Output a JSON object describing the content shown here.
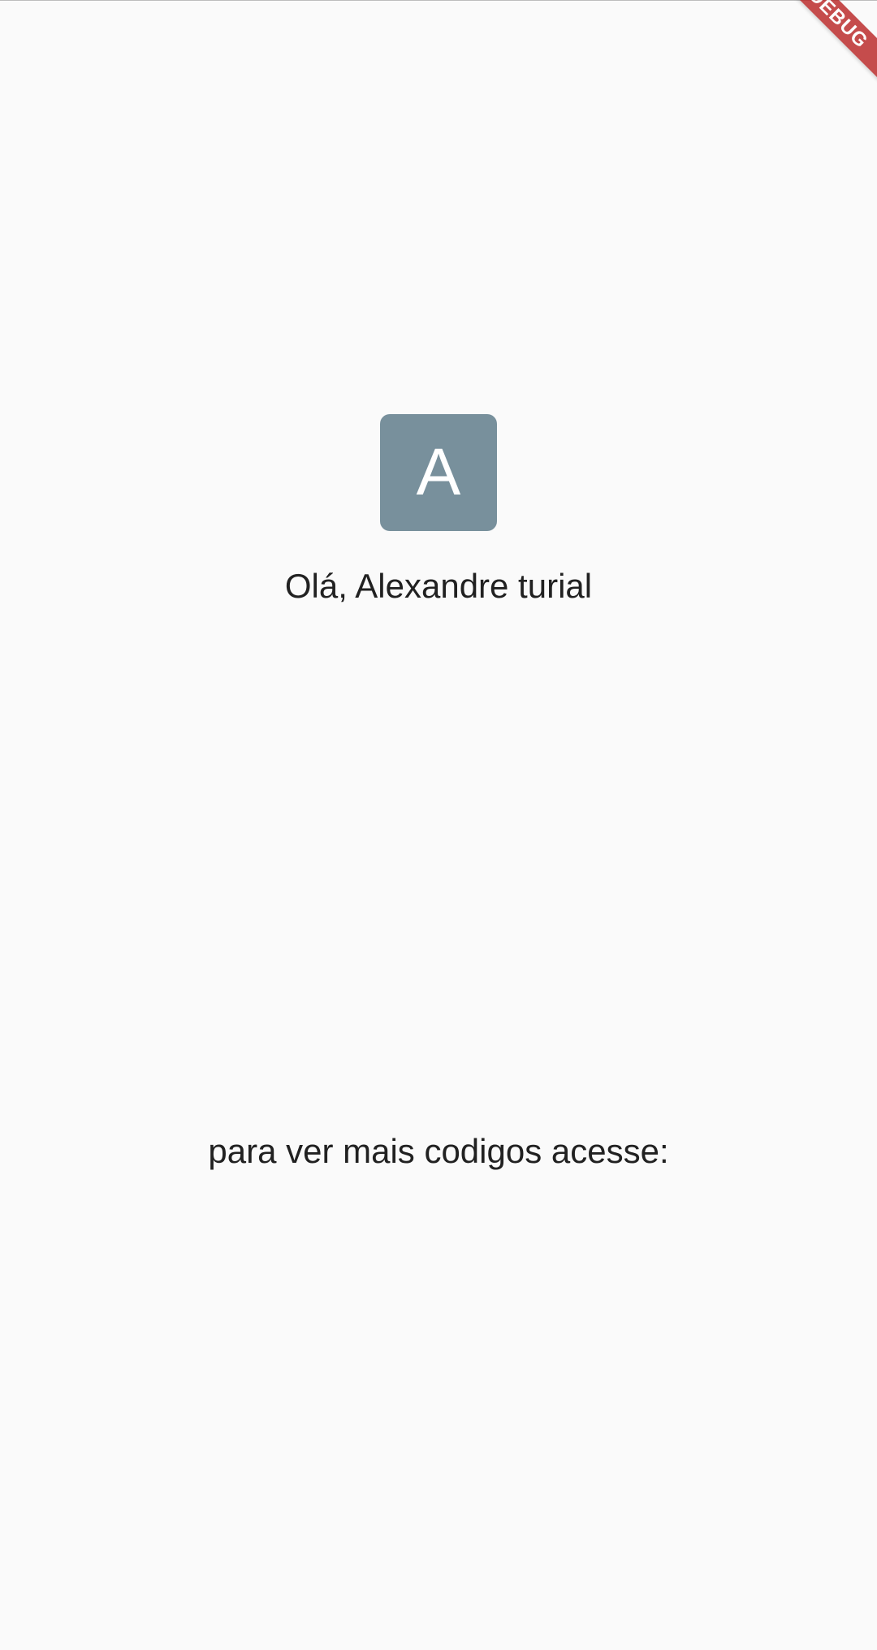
{
  "profile": {
    "avatar_initial": "A",
    "greeting": "Olá, Alexandre turial"
  },
  "footer": {
    "text": "para ver mais codigos acesse:"
  },
  "debug_banner": {
    "label": "DEBUG"
  },
  "colors": {
    "background": "#fafafa",
    "avatar_background": "#78909c",
    "text": "#212121",
    "debug_banner": "#b71c1c"
  }
}
